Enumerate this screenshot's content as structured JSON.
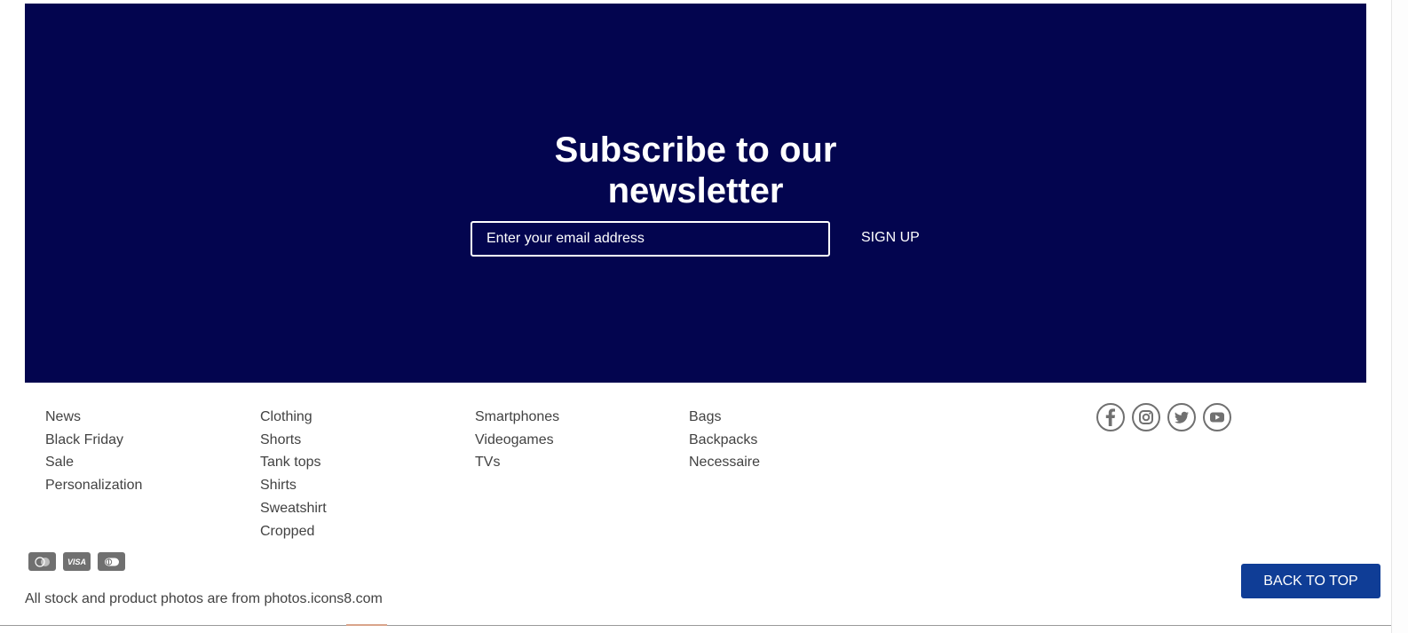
{
  "newsletter": {
    "title_line1": "Subscribe to our",
    "title_line2": "newsletter",
    "email_placeholder": "Enter your email address",
    "signup_label": "SIGN UP",
    "background_color": "#03054f"
  },
  "footer": {
    "columns": [
      [
        "News",
        "Black Friday",
        "Sale",
        "Personalization"
      ],
      [
        "Clothing",
        "Shorts",
        "Tank tops",
        "Shirts",
        "Sweatshirt",
        "Cropped"
      ],
      [
        "Smartphones",
        "Videogames",
        "TVs"
      ],
      [
        "Bags",
        "Backpacks",
        "Necessaire"
      ]
    ],
    "social_icons": [
      "facebook-icon",
      "instagram-icon",
      "twitter-icon",
      "youtube-icon"
    ],
    "payment_icons": [
      "mastercard-icon",
      "visa-icon",
      "diners-club-icon"
    ],
    "payment_visa_text": "VISA",
    "credits": "All stock and product photos are from photos.icons8.com",
    "back_to_top_label": "BACK TO TOP",
    "back_to_top_color": "#0f3d96"
  }
}
